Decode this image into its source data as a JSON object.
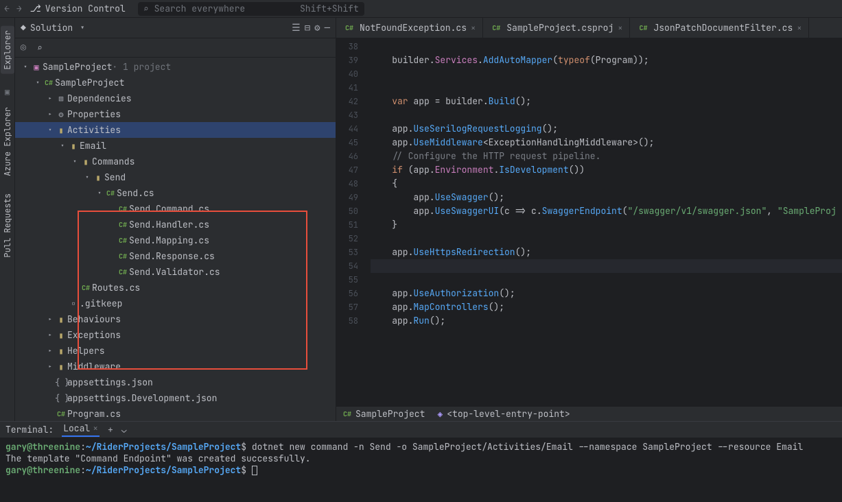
{
  "topbar": {
    "branch": "Version Control",
    "search_placeholder": "Search everywhere",
    "search_shortcut": "Shift+Shift"
  },
  "leftTools": [
    "Explorer",
    "Azure Explorer",
    "Pull Requests"
  ],
  "explorer": {
    "title": "Solution",
    "nodes": [
      {
        "d": 0,
        "ch": "open",
        "icon": "sln",
        "label": "SampleProject",
        "suffix": " · 1 project"
      },
      {
        "d": 1,
        "ch": "open",
        "icon": "csproj",
        "label": "SampleProject"
      },
      {
        "d": 2,
        "ch": "closed",
        "icon": "dep",
        "label": "Dependencies"
      },
      {
        "d": 2,
        "ch": "closed",
        "icon": "prop",
        "label": "Properties"
      },
      {
        "d": 2,
        "ch": "open",
        "icon": "folder",
        "label": "Activities",
        "selected": true
      },
      {
        "d": 3,
        "ch": "open",
        "icon": "folder",
        "label": "Email"
      },
      {
        "d": 4,
        "ch": "open",
        "icon": "folder",
        "label": "Commands"
      },
      {
        "d": 5,
        "ch": "open",
        "icon": "folder",
        "label": "Send"
      },
      {
        "d": 6,
        "ch": "open",
        "icon": "cs",
        "label": "Send.cs"
      },
      {
        "d": 7,
        "ch": "none",
        "icon": "cs",
        "label": "Send.Command.cs"
      },
      {
        "d": 7,
        "ch": "none",
        "icon": "cs",
        "label": "Send.Handler.cs"
      },
      {
        "d": 7,
        "ch": "none",
        "icon": "cs",
        "label": "Send.Mapping.cs"
      },
      {
        "d": 7,
        "ch": "none",
        "icon": "cs",
        "label": "Send.Response.cs"
      },
      {
        "d": 7,
        "ch": "none",
        "icon": "cs",
        "label": "Send.Validator.cs"
      },
      {
        "d": 4,
        "ch": "none",
        "icon": "cs",
        "label": "Routes.cs"
      },
      {
        "d": 3,
        "ch": "none",
        "icon": "file",
        "label": ".gitkeep"
      },
      {
        "d": 2,
        "ch": "closed",
        "icon": "folder",
        "label": "Behaviours"
      },
      {
        "d": 2,
        "ch": "closed",
        "icon": "folder",
        "label": "Exceptions"
      },
      {
        "d": 2,
        "ch": "closed",
        "icon": "folder",
        "label": "Helpers"
      },
      {
        "d": 2,
        "ch": "closed",
        "icon": "folder",
        "label": "Middleware"
      },
      {
        "d": 2,
        "ch": "none",
        "icon": "json",
        "label": "appsettings.json"
      },
      {
        "d": 2,
        "ch": "none",
        "icon": "json",
        "label": "appsettings.Development.json"
      },
      {
        "d": 2,
        "ch": "none",
        "icon": "cs",
        "label": "Program.cs"
      }
    ]
  },
  "tabs": [
    {
      "icon": "cs",
      "label": "NotFoundException.cs"
    },
    {
      "icon": "csproj",
      "label": "SampleProject.csproj"
    },
    {
      "icon": "cs",
      "label": "JsonPatchDocumentFilter.cs"
    }
  ],
  "code": {
    "startLine": 38,
    "currentLine": 54,
    "lines": [
      "",
      "    builder.<span class='ident'>Services</span>.<span class='method'>AddAutoMapper</span>(<span class='kw'>typeof</span>(<span class='type'>Program</span>));",
      "",
      "",
      "    <span class='kw'>var</span> <span class='type'>app</span> = builder.<span class='method'>Build</span>();",
      "",
      "    app.<span class='method'>UseSerilogRequestLogging</span>();",
      "    app.<span class='method'>UseMiddleware</span>&lt;<span class='type'>ExceptionHandlingMiddleware</span>&gt;();",
      "    <span class='comment'>// Configure the HTTP request pipeline.</span>",
      "    <span class='kw'>if</span> (app.<span class='ident'>Environment</span>.<span class='method'>IsDevelopment</span>())",
      "    {",
      "        app.<span class='method'>UseSwagger</span>();",
      "        app.<span class='method'>UseSwaggerUI</span>(c <span class='op'>=&gt;</span> c.<span class='method'>SwaggerEndpoint</span>(<span class='str'>\"/swagger/v1/swagger.json\"</span>, <span class='str'>\"SampleProj</span>",
      "    }",
      "",
      "    app.<span class='method'>UseHttpsRedirection</span>();",
      "",
      "",
      "    app.<span class='method'>UseAuthorization</span>();",
      "    app.<span class='method'>MapControllers</span>();",
      "    app.<span class='method'>Run</span>();"
    ]
  },
  "statusEditor": {
    "project": "SampleProject",
    "context": "<top-level-entry-point>"
  },
  "terminal": {
    "title": "Terminal:",
    "tab": "Local",
    "user": "gary@threenine",
    "path": "~/RiderProjects/SampleProject",
    "cmd": "dotnet new command -n Send -o SampleProject/Activities/Email --namespace SampleProject --resource Email",
    "output": "The template \"Command Endpoint\" was created successfully."
  }
}
